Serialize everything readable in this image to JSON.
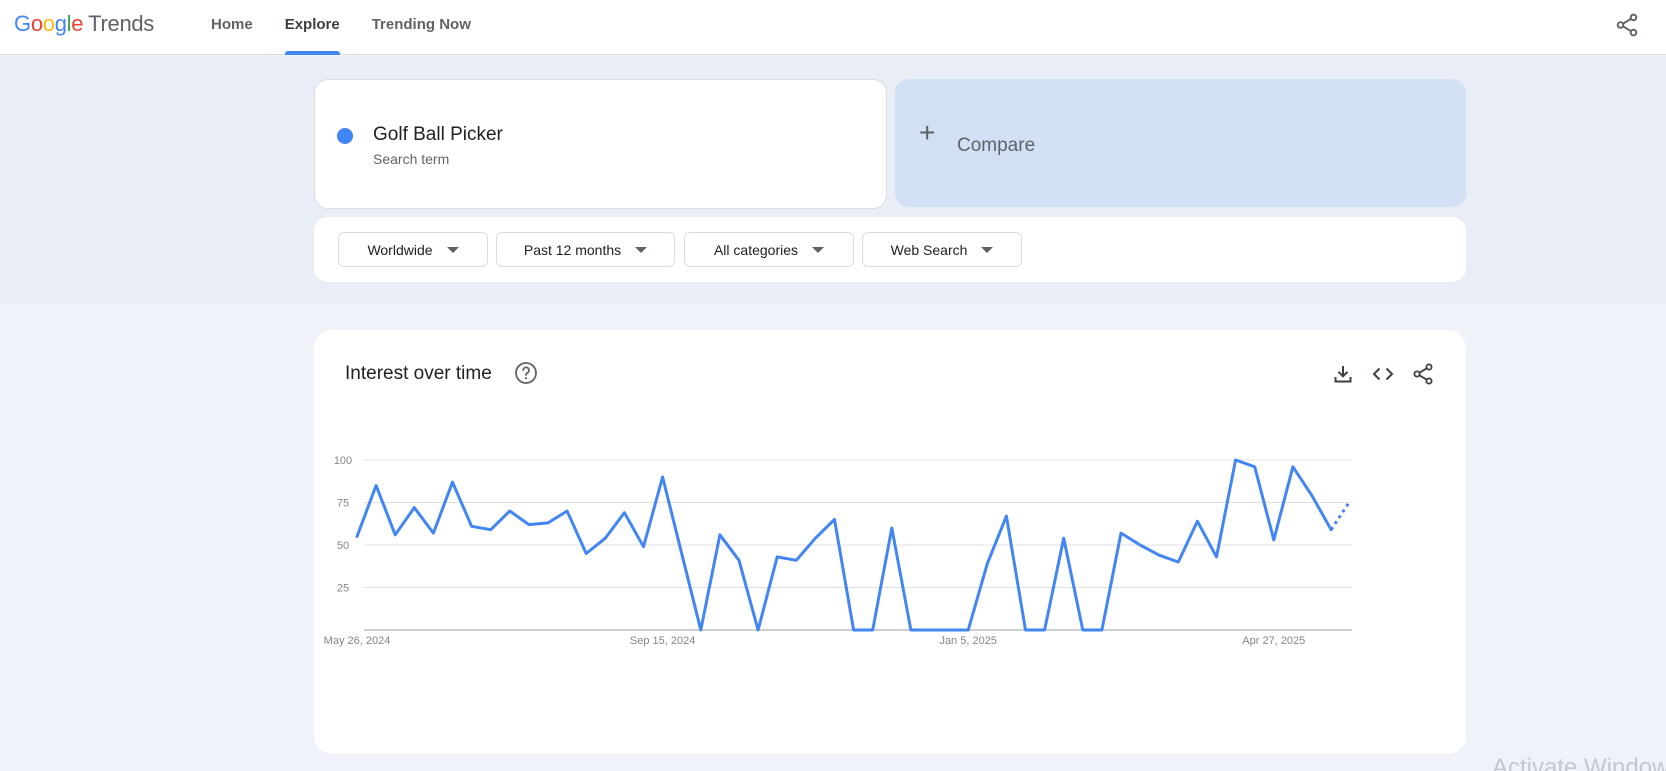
{
  "header": {
    "logo_google": "Google",
    "logo_trends": "Trends",
    "tabs": [
      {
        "label": "Home",
        "active": false
      },
      {
        "label": "Explore",
        "active": true
      },
      {
        "label": "Trending Now",
        "active": false
      }
    ],
    "share_icon": "share-icon"
  },
  "search": {
    "term": "Golf Ball Picker",
    "term_subtitle": "Search term",
    "term_color": "#4285f4",
    "compare_label": "Compare"
  },
  "filters": {
    "region": "Worldwide",
    "time_range": "Past 12 months",
    "category": "All categories",
    "search_type": "Web Search"
  },
  "chart_card": {
    "title": "Interest over time",
    "icons": [
      "help-icon",
      "download-icon",
      "embed-icon",
      "share-icon"
    ]
  },
  "chart_data": {
    "type": "line",
    "title": "Interest over time",
    "x_tick_labels": [
      "May 26, 2024",
      "Sep 15, 2024",
      "Jan 5, 2025",
      "Apr 27, 2025"
    ],
    "y_ticks": [
      25,
      50,
      75,
      100
    ],
    "ylim": [
      0,
      100
    ],
    "grid": true,
    "series": [
      {
        "name": "Golf Ball Picker",
        "color": "#4285f4",
        "values": [
          55,
          85,
          56,
          72,
          57,
          87,
          61,
          59,
          70,
          62,
          63,
          70,
          45,
          54,
          69,
          49,
          90,
          45,
          0,
          56,
          41,
          0,
          43,
          41,
          54,
          65,
          0,
          0,
          60,
          0,
          0,
          0,
          0,
          39,
          67,
          0,
          0,
          54,
          0,
          0,
          57,
          50,
          44,
          40,
          64,
          43,
          100,
          96,
          53,
          96,
          79,
          59
        ],
        "partial_values": [
          59,
          76
        ]
      }
    ]
  },
  "watermark": "Activate Windows"
}
